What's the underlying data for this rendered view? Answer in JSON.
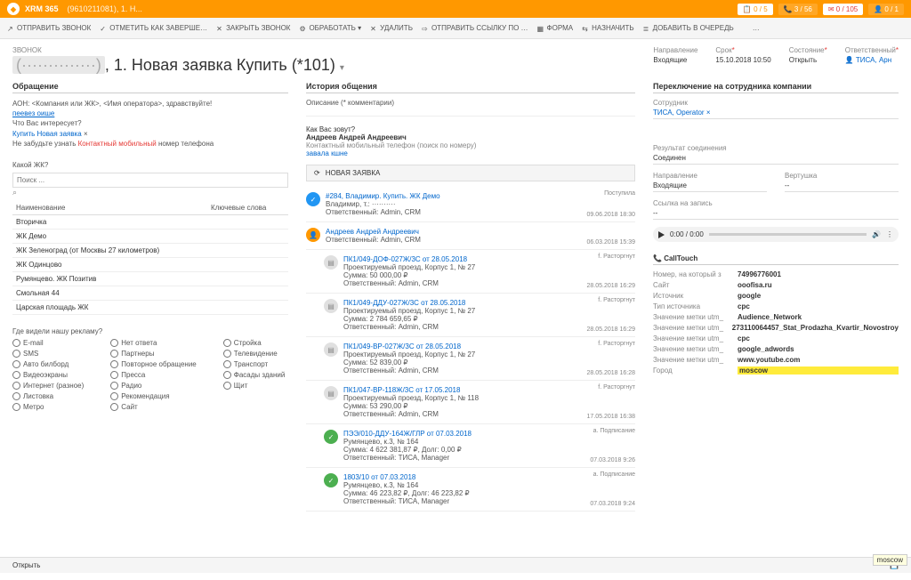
{
  "header": {
    "brand": "XRM 365",
    "crumb": "(9610211081), 1. Н...",
    "stats": [
      {
        "icon": "📋",
        "text": "0 / 5"
      },
      {
        "icon": "📞",
        "text": "3 / 56"
      },
      {
        "icon": "✉",
        "text": "0 / 105"
      },
      {
        "icon": "👤",
        "text": "0 / 1"
      }
    ]
  },
  "commands": [
    "ОТПРАВИТЬ ЗВОНОК",
    "ОТМЕТИТЬ КАК ЗАВЕРШЕ…",
    "ЗАКРЫТЬ ЗВОНОК",
    "ОБРАБОТАТЬ ▾",
    "УДАЛИТЬ",
    "ОТПРАВИТЬ ССЫЛКУ ПО …",
    "ФОРМА",
    "НАЗНАЧИТЬ",
    "ДОБАВИТЬ В ОЧЕРЕДЬ",
    "…"
  ],
  "cmd_icons": [
    "↗",
    "✓",
    "✕",
    "⚙",
    "✕",
    "⇨",
    "▦",
    "⇆",
    "≣",
    ""
  ],
  "page": {
    "breadcrumb": "ЗВОНОК",
    "title_masked": "(··············)",
    "title_rest": ", 1. Новая заявка Купить (*101)",
    "meta": [
      {
        "lab": "Направление",
        "val": "Входящие"
      },
      {
        "lab": "Срок",
        "val": "15.10.2018 10:50",
        "req": true
      },
      {
        "lab": "Состояние",
        "val": "Открыть",
        "req": true
      },
      {
        "lab": "Ответственный",
        "val": "👤 ТИСА, Арн",
        "req": true,
        "link": true
      }
    ]
  },
  "left": {
    "section": "Обращение",
    "script_l1": "АОН: <Компания или ЖК>, <Имя оператора>, здравствуйте!",
    "script_blue": "пеевез оише",
    "script_l2": "Что Вас интересует?",
    "script_link": "Купить Новая заявка",
    "script_l3_a": "Не забудьте узнать ",
    "script_l3_b": "Контактный мобильный",
    "script_l3_c": " номер телефона",
    "sub1": "Какой ЖК?",
    "search_ph": "Поиск ...",
    "th1": "Наименование",
    "th2": "Ключевые слова",
    "rows": [
      "Вторичка",
      "ЖК Демо",
      "ЖК Зеленоград (от Москвы 27 километров)",
      "ЖК Одинцово",
      "Румянцево. ЖК Позитив",
      "Смольная 44",
      "Царская площадь ЖК"
    ],
    "sub2": "Где видели нашу рекламу?",
    "radios": [
      [
        "E-mail",
        "SMS",
        "Авто билборд",
        "Видеоэкраны",
        "Интернет (разное)",
        "Листовка",
        "Метро"
      ],
      [
        "Нет ответа",
        "Партнеры",
        "Повторное обращение",
        "Пресса",
        "Радио",
        "Рекомендация",
        "Сайт"
      ],
      [
        "Стройка",
        "Телевидение",
        "Транспорт",
        "Фасады зданий",
        "Щит"
      ]
    ]
  },
  "mid": {
    "section": "История общения",
    "desc": "Описание (* комментарии)",
    "q1": "Как Вас зовут?",
    "name": "Андреев Андрей Андреевич",
    "phone_lab": "Контактный мобильный телефон (поиск по номеру)",
    "phone_link": "завала кшне",
    "tab": "НОВАЯ ЗАЯВКА",
    "feed": [
      {
        "av": "blue",
        "ch": "✓",
        "title": "#284, Владимир. Купить. ЖК Демо",
        "sub1": "Владимир, т.: ··········",
        "sub2": "Ответственный: Admin, CRM",
        "status": "Поступила",
        "ts": "09.06.2018 18:30"
      },
      {
        "av": "orange",
        "ch": "👤",
        "title": "Андреев Андрей Андреевич",
        "sub2": "Ответственный: Admin, CRM",
        "status": "",
        "ts": "06.03.2018 15:39"
      },
      {
        "av": "grey",
        "ch": "▤",
        "nested": true,
        "title": "ПК1/049-ДОФ-027Ж/3С от 28.05.2018",
        "sub1": "Проектируемый проезд, Корпус 1, № 27",
        "sub2": "Сумма: 50 000,00 ₽",
        "sub3": "Ответственный: Admin, CRM",
        "status": "f. Расторгнут",
        "ts": "28.05.2018 16:29"
      },
      {
        "av": "grey",
        "ch": "▤",
        "nested": true,
        "title": "ПК1/049-ДДУ-027Ж/3С от 28.05.2018",
        "sub1": "Проектируемый проезд, Корпус 1, № 27",
        "sub2": "Сумма: 2 784 659,65 ₽",
        "sub3": "Ответственный: Admin, CRM",
        "status": "f. Расторгнут",
        "ts": "28.05.2018 16:29"
      },
      {
        "av": "grey",
        "ch": "▤",
        "nested": true,
        "title": "ПК1/049-ВР-027Ж/3С от 28.05.2018",
        "sub1": "Проектируемый проезд, Корпус 1, № 27",
        "sub2": "Сумма: 52 839,00 ₽",
        "sub3": "Ответственный: Admin, CRM",
        "status": "f. Расторгнут",
        "ts": "28.05.2018 16:28"
      },
      {
        "av": "grey",
        "ch": "▤",
        "nested": true,
        "title": "ПК1/047-ВР-118Ж/3С от 17.05.2018",
        "sub1": "Проектируемый проезд, Корпус 1, № 118",
        "sub2": "Сумма: 53 290,00 ₽",
        "sub3": "Ответственный: Admin, CRM",
        "status": "f. Расторгнут",
        "ts": "17.05.2018 16:38"
      },
      {
        "av": "green",
        "ch": "✓",
        "nested": true,
        "title": "ПЭЭ/010-ДДУ-164Ж/ГЛР от 07.03.2018",
        "sub1": "Румянцево, к.3, № 164",
        "sub2": "Сумма: 4 622 381,87 ₽, Долг: 0,00 ₽",
        "sub3": "Ответственный: ТИСА, Manager",
        "status": "a. Подписание",
        "ts": "07.03.2018 9:26"
      },
      {
        "av": "green",
        "ch": "✓",
        "nested": true,
        "title": "1803/10 от 07.03.2018",
        "sub1": "Румянцево, к.3, № 164",
        "sub2": "Сумма: 46 223,82 ₽, Долг: 46 223,82 ₽",
        "sub3": "Ответственный: ТИСА, Manager",
        "status": "a. Подписание",
        "ts": "07.03.2018 9:24"
      }
    ]
  },
  "right": {
    "section": "Переключение на сотрудника компании",
    "emp_lab": "Сотрудник",
    "emp_val": "ТИСА, Operator ×",
    "res_lab": "Результат соединения",
    "res_val": "Соединен",
    "dir_lab": "Направление",
    "dir_val": "Входящие",
    "vert_lab": "Вертушка",
    "vert_val": "--",
    "rec_lab": "Ссылка на запись",
    "rec_val": "--",
    "audio_time": "0:00 / 0:00",
    "ct": "CallTouch",
    "ct_rows": [
      {
        "k": "Номер, на который з",
        "v": "74996776001"
      },
      {
        "k": "Сайт",
        "v": "ooofisa.ru"
      },
      {
        "k": "Источник",
        "v": "google"
      },
      {
        "k": "Тип источника",
        "v": "cpc"
      },
      {
        "k": "Значение метки utm_",
        "v": "Audience_Network"
      },
      {
        "k": "Значение метки utm_",
        "v": "273110064457_Stat_Prodazha_Kvartir_Novostroy"
      },
      {
        "k": "Значение метки utm_",
        "v": "cpc"
      },
      {
        "k": "Значение метки utm_",
        "v": "google_adwords"
      },
      {
        "k": "Значение метки utm_",
        "v": "www.youtube.com"
      },
      {
        "k": "Город",
        "v": "moscow",
        "hl": true
      }
    ]
  },
  "footer": {
    "left": "Открыть"
  },
  "tooltip": "moscow"
}
